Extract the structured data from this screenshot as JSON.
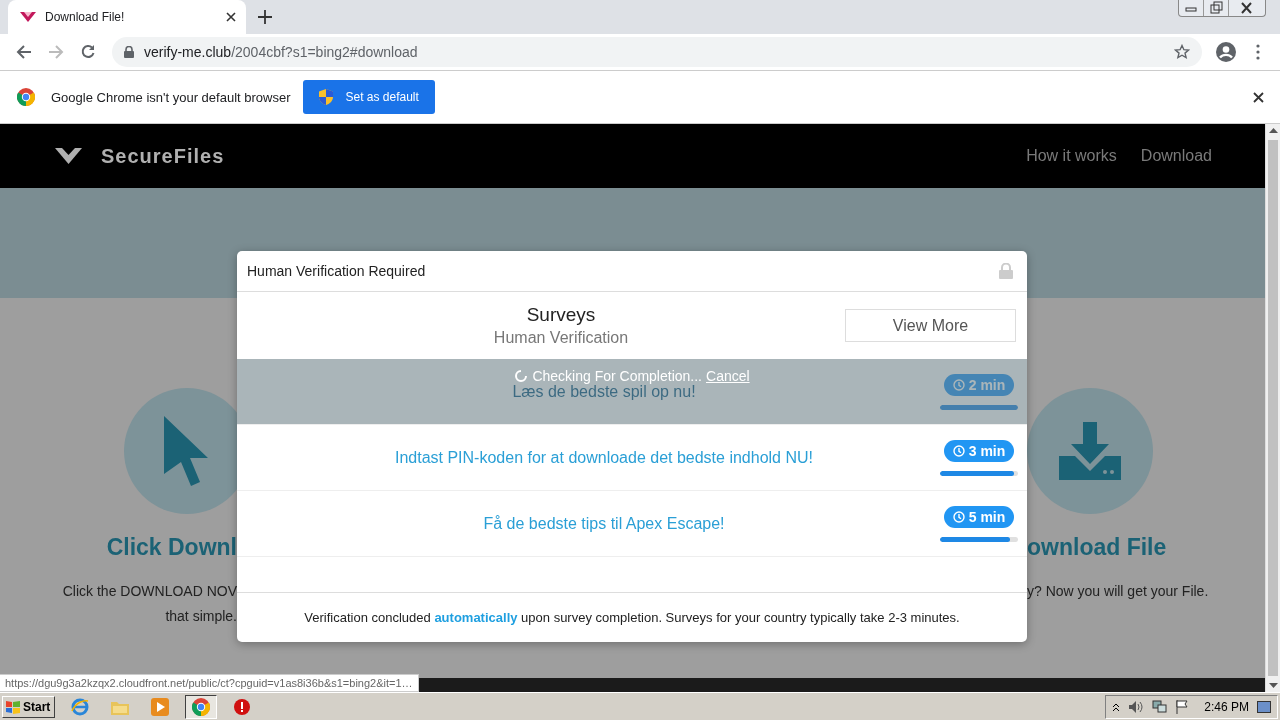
{
  "browser": {
    "tab": {
      "title": "Download File!"
    },
    "url": {
      "domain": "verify-me.club",
      "path": "/2004cbf?s1=bing2#download"
    },
    "infobar": {
      "message": "Google Chrome isn't your default browser",
      "button": "Set as default"
    },
    "status_url": "https://dgu9g3a2kzqx2.cloudfront.net/public/ct?cpguid=v1as8i36b&s1=bing2&it=1…"
  },
  "site": {
    "brand": "SecureFiles",
    "nav": [
      {
        "label": "How it works"
      },
      {
        "label": "Download"
      }
    ],
    "left_feature": {
      "title": "Click Downl",
      "lines": [
        "Click the DOWNLOAD NOV",
        "that simple."
      ]
    },
    "right_feature": {
      "title": "ownload File",
      "lines": [
        "y? Now you will get your File."
      ]
    }
  },
  "modal": {
    "title": "Human Verification Required",
    "heading": "Surveys",
    "subheading": "Human Verification",
    "button": "View More",
    "checking": {
      "text": "Checking For Completion...",
      "cancel": "Cancel"
    },
    "offers": [
      {
        "title": "Læs de bedste spil op nu!",
        "time": "2 min",
        "level": 1,
        "checking": true
      },
      {
        "title": "Indtast PIN-koden for at downloade det bedste indhold NU!",
        "time": "3 min",
        "level": 0.95,
        "checking": false
      },
      {
        "title": "Få de bedste tips til Apex Escape!",
        "time": "5 min",
        "level": 0.9,
        "checking": false
      }
    ],
    "footer": "Verification concluded **automatically** upon survey completion. Surveys for your country typically take 2-3 minutes."
  },
  "taskbar": {
    "start": "Start",
    "clock": "2:46 PM"
  }
}
